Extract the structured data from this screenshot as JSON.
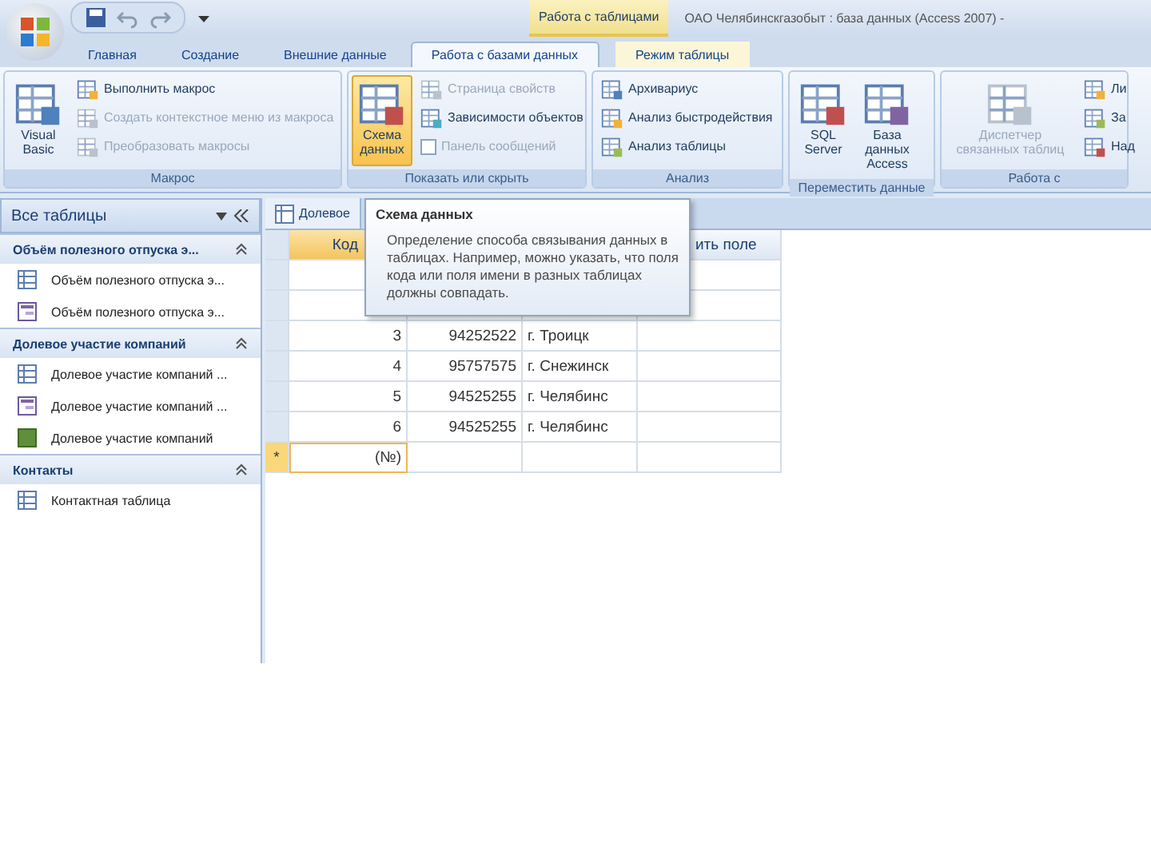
{
  "window": {
    "title": "ОАО Челябинскгазобыт : база данных (Access 2007) -",
    "contextual_tab": "Работа с таблицами"
  },
  "tabs": [
    {
      "label": "Главная",
      "selected": false
    },
    {
      "label": "Создание",
      "selected": false
    },
    {
      "label": "Внешние данные",
      "selected": false
    },
    {
      "label": "Работа с базами данных",
      "selected": true
    },
    {
      "label": "Режим таблицы",
      "selected": false
    }
  ],
  "ribbon": {
    "groups": [
      {
        "label": "Макрос",
        "items": [
          {
            "kind": "large",
            "label": "Visual Basic",
            "disabled": false,
            "hovered": false
          },
          {
            "kind": "small",
            "label": "Выполнить макрос",
            "disabled": false,
            "hovered": false
          },
          {
            "kind": "small",
            "label": "Создать контекстное меню из макроса",
            "disabled": true,
            "hovered": false
          },
          {
            "kind": "small",
            "label": "Преобразовать макросы",
            "disabled": true,
            "hovered": false
          }
        ]
      },
      {
        "label": "Показать или скрыть",
        "items": [
          {
            "kind": "large",
            "label": "Схема данных",
            "disabled": false,
            "hovered": true
          },
          {
            "kind": "small",
            "label": "Страница свойств",
            "disabled": true,
            "hovered": false
          },
          {
            "kind": "small",
            "label": "Зависимости объектов",
            "disabled": false,
            "hovered": false
          },
          {
            "kind": "checkbox",
            "label": "Панель сообщений",
            "checked": false,
            "disabled": true,
            "hovered": false
          }
        ]
      },
      {
        "label": "Анализ",
        "items": [
          {
            "kind": "small",
            "label": "Архивариус",
            "disabled": false,
            "hovered": false
          },
          {
            "kind": "small",
            "label": "Анализ быстродействия",
            "disabled": false,
            "hovered": false
          },
          {
            "kind": "small",
            "label": "Анализ таблицы",
            "disabled": false,
            "hovered": false
          }
        ]
      },
      {
        "label": "Переместить данные",
        "items": [
          {
            "kind": "large",
            "label": "SQL Server",
            "disabled": false,
            "hovered": false
          },
          {
            "kind": "large",
            "label": "База данных Access",
            "disabled": false,
            "hovered": false
          }
        ]
      },
      {
        "label": "Работа с",
        "items": [
          {
            "kind": "large",
            "label": "Диспетчер связанных таблиц",
            "disabled": true,
            "hovered": false
          },
          {
            "kind": "small",
            "label": "Ли",
            "disabled": false,
            "hovered": false
          },
          {
            "kind": "small",
            "label": "За",
            "disabled": false,
            "hovered": false
          },
          {
            "kind": "small",
            "label": "Над",
            "disabled": false,
            "hovered": false
          }
        ]
      }
    ]
  },
  "nav": {
    "header": "Все таблицы",
    "groups": [
      {
        "label": "Объём полезного отпуска э...",
        "expanded": true,
        "items": [
          {
            "kind": "table",
            "label": "Объём полезного отпуска э..."
          },
          {
            "kind": "form",
            "label": "Объём полезного отпуска э..."
          }
        ]
      },
      {
        "label": "Долевое участие компаний",
        "expanded": true,
        "items": [
          {
            "kind": "table",
            "label": "Долевое участие компаний ..."
          },
          {
            "kind": "form",
            "label": "Долевое участие компаний ..."
          },
          {
            "kind": "report",
            "label": "Долевое участие компаний"
          }
        ]
      },
      {
        "label": "Контакты",
        "expanded": true,
        "items": [
          {
            "kind": "table",
            "label": "Контактная таблица"
          }
        ]
      }
    ]
  },
  "document": {
    "tab": "Долевое",
    "grid": {
      "column_1": "Код",
      "column_4": "ить поле",
      "rows": [
        [
          "3",
          "94252522",
          "г. Троицк"
        ],
        [
          "4",
          "95757575",
          "г. Снежинск"
        ],
        [
          "5",
          "94525255",
          "г. Челябинс"
        ],
        [
          "6",
          "94525255",
          "г. Челябинс"
        ]
      ],
      "new_row": {
        "marker": "*",
        "value": "(№)"
      }
    }
  },
  "tooltip": {
    "title": "Схема данных",
    "text": "Определение способа связывания данных в таблицах. Например, можно указать, что поля кода или поля имени в разных таблицах должны совпадать."
  }
}
